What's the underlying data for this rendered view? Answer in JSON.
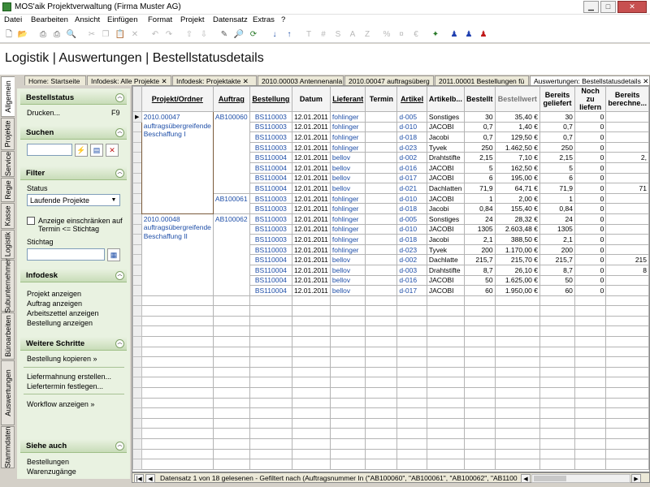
{
  "window": {
    "title": "MOS'aik Projektverwaltung (Firma Muster AG)"
  },
  "menu": [
    "Datei",
    "Bearbeiten",
    "Ansicht",
    "Einfügen",
    "Format",
    "Projekt",
    "Datensatz",
    "Extras",
    "?"
  ],
  "toolbar": {
    "icons": [
      "new-icon",
      "open-icon",
      "print-icon",
      "print-preview-icon",
      "preview-icon",
      "cut-icon",
      "copy-icon",
      "paste-icon",
      "delete-icon",
      "undo-icon",
      "redo-icon",
      "move-up-icon",
      "move-down-icon",
      "edit-icon",
      "find-icon",
      "refresh-icon",
      "sort-asc-icon",
      "sort-desc-icon",
      "text-icon",
      "hash-icon",
      "s-icon",
      "a-icon",
      "z-icon",
      "percent-icon",
      "currency-icon",
      "euro-icon",
      "tool-icon",
      "user-blue-icon",
      "user-red-icon"
    ]
  },
  "page_title": "Logistik | Auswertungen | Bestellstatusdetails",
  "vtabs": [
    "Allgemein",
    "Projekte",
    "Service",
    "Regie",
    "Kasse",
    "Logistik",
    "Subunternehmer",
    "Büroarbeiten",
    "Auswertungen",
    "Stammdaten"
  ],
  "doc_tabs": [
    "Home: Startseite",
    "Infodesk: Alle Projekte",
    "Infodesk: Projektakte",
    "2010.00003 Antennenanla",
    "2010.00047 auftragsüberg",
    "2011.00001 Bestellungen fü",
    "Auswertungen: Bestellstatusdetails"
  ],
  "sidebar": {
    "bestellstatus": {
      "title": "Bestellstatus",
      "print_label": "Drucken...",
      "print_key": "F9"
    },
    "suchen": {
      "title": "Suchen"
    },
    "filter": {
      "title": "Filter",
      "status_label": "Status",
      "status_value": "Laufende Projekte",
      "checkbox_label": "Anzeige einschränken auf Termin <= Stichtag",
      "stichtag_label": "Stichtag"
    },
    "infodesk": {
      "title": "Infodesk",
      "items": [
        "Projekt anzeigen",
        "Auftrag anzeigen",
        "Arbeitszettel anzeigen",
        "Bestellung anzeigen"
      ]
    },
    "weitere": {
      "title": "Weitere Schritte",
      "items": [
        "Bestellung kopieren »",
        "Liefermahnung erstellen...",
        "Liefertermin festlegen...",
        "Workflow anzeigen »"
      ]
    },
    "siehe": {
      "title": "Siehe auch",
      "items": [
        "Bestellungen",
        "Warenzugänge"
      ]
    }
  },
  "grid": {
    "headers": [
      "Projekt/Ordner",
      "Auftrag",
      "Bestellung",
      "Datum",
      "Lieferant",
      "Termin",
      "Artikel",
      "Artikelb...",
      "Bestellt",
      "Bestellwert",
      "Bereits geliefert",
      "Noch zu liefern",
      "Bereits berechne..."
    ],
    "groups": [
      {
        "project": "2010.00047 auftragsübergreifende Beschaffung I",
        "order": "AB100060"
      },
      {
        "project": "2010.00048 auftragsübergreifende Beschaffung II",
        "order": "AB100062"
      }
    ],
    "order_2": "AB100061",
    "rows": [
      [
        "BS110003",
        "12.01.2011",
        "fohlinger",
        "",
        "d-005",
        "Sonstiges",
        "30",
        "35,40 €",
        "30",
        "0",
        ""
      ],
      [
        "BS110003",
        "12.01.2011",
        "fohlinger",
        "",
        "d-010",
        "JACOBI",
        "0,7",
        "1,40 €",
        "0,7",
        "0",
        ""
      ],
      [
        "BS110003",
        "12.01.2011",
        "fohlinger",
        "",
        "d-018",
        "Jacobi",
        "0,7",
        "129,50 €",
        "0,7",
        "0",
        ""
      ],
      [
        "BS110003",
        "12.01.2011",
        "fohlinger",
        "",
        "d-023",
        "Tyvek",
        "250",
        "1.462,50 €",
        "250",
        "0",
        ""
      ],
      [
        "BS110004",
        "12.01.2011",
        "bellov",
        "",
        "d-002",
        "Drahtstifte",
        "2,15",
        "7,10 €",
        "2,15",
        "0",
        "2,"
      ],
      [
        "BS110004",
        "12.01.2011",
        "bellov",
        "",
        "d-016",
        "JACOBI",
        "5",
        "162,50 €",
        "5",
        "0",
        ""
      ],
      [
        "BS110004",
        "12.01.2011",
        "bellov",
        "",
        "d-017",
        "JACOBI",
        "6",
        "195,00 €",
        "6",
        "0",
        ""
      ],
      [
        "BS110004",
        "12.01.2011",
        "bellov",
        "",
        "d-021",
        "Dachlatten",
        "71,9",
        "64,71 €",
        "71,9",
        "0",
        "71"
      ],
      [
        "BS110003",
        "12.01.2011",
        "fohlinger",
        "",
        "d-010",
        "JACOBI",
        "1",
        "2,00 €",
        "1",
        "0",
        ""
      ],
      [
        "BS110003",
        "12.01.2011",
        "fohlinger",
        "",
        "d-018",
        "Jacobi",
        "0,84",
        "155,40 €",
        "0,84",
        "0",
        ""
      ],
      [
        "BS110003",
        "12.01.2011",
        "fohlinger",
        "",
        "d-005",
        "Sonstiges",
        "24",
        "28,32 €",
        "24",
        "0",
        ""
      ],
      [
        "BS110003",
        "12.01.2011",
        "fohlinger",
        "",
        "d-010",
        "JACOBI",
        "1305",
        "2.603,48 €",
        "1305",
        "0",
        ""
      ],
      [
        "BS110003",
        "12.01.2011",
        "fohlinger",
        "",
        "d-018",
        "Jacobi",
        "2,1",
        "388,50 €",
        "2,1",
        "0",
        ""
      ],
      [
        "BS110003",
        "12.01.2011",
        "fohlinger",
        "",
        "d-023",
        "Tyvek",
        "200",
        "1.170,00 €",
        "200",
        "0",
        ""
      ],
      [
        "BS110004",
        "12.01.2011",
        "bellov",
        "",
        "d-002",
        "Dachlatte",
        "215,7",
        "215,70 €",
        "215,7",
        "0",
        "215"
      ],
      [
        "BS110004",
        "12.01.2011",
        "bellov",
        "",
        "d-003",
        "Drahtstifte",
        "8,7",
        "26,10 €",
        "8,7",
        "0",
        "8"
      ],
      [
        "BS110004",
        "12.01.2011",
        "bellov",
        "",
        "d-016",
        "JACOBI",
        "50",
        "1.625,00 €",
        "50",
        "0",
        ""
      ],
      [
        "BS110004",
        "12.01.2011",
        "bellov",
        "",
        "d-017",
        "JACOBI",
        "60",
        "1.950,00 €",
        "60",
        "0",
        ""
      ]
    ]
  },
  "status": {
    "text": "Datensatz 1 von 18 gelesenen - Gefiltert nach (Auftragsnummer In (\"AB100060\", \"AB100061\", \"AB100062\", \"AB110008\"))"
  }
}
